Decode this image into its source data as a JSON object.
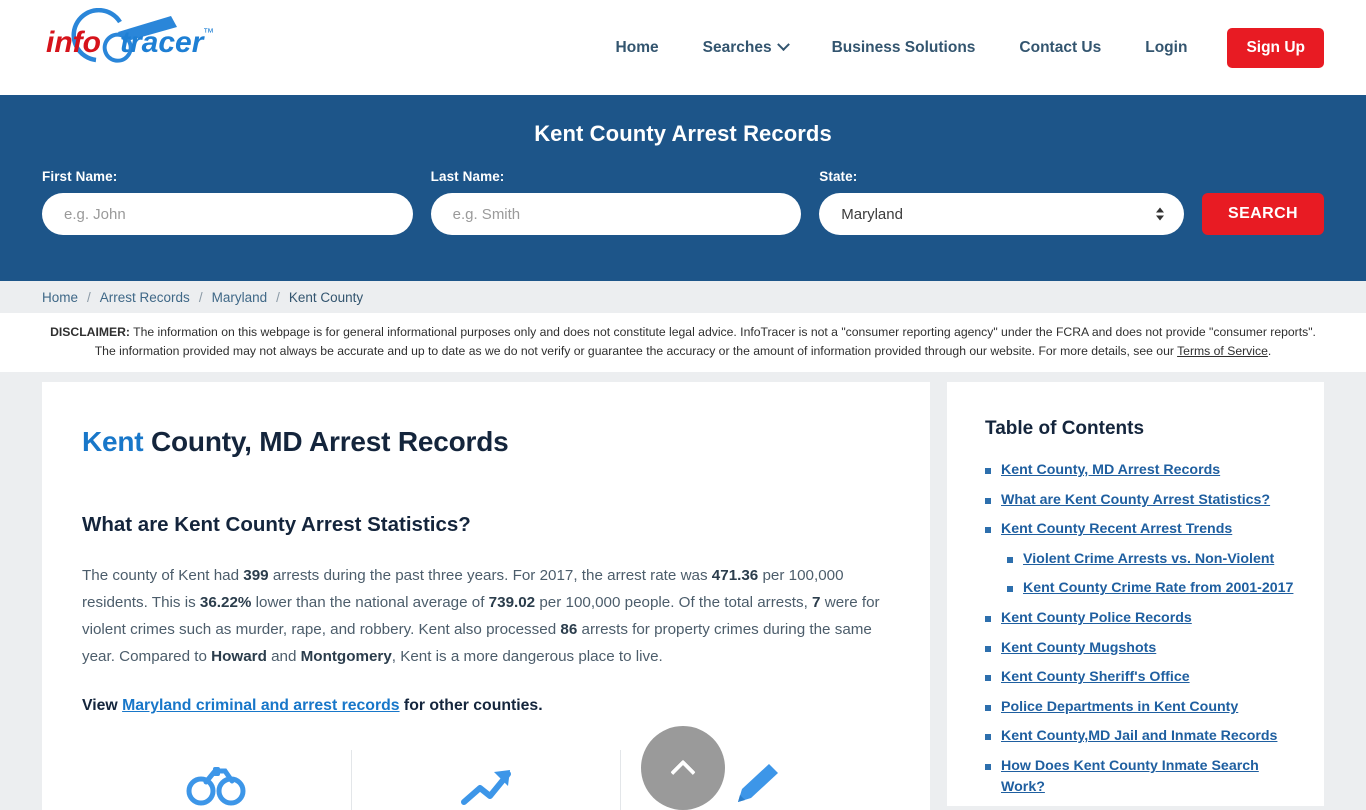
{
  "brand": {
    "logo_text_primary": "info",
    "logo_text_secondary": "tracer",
    "logo_trademark": "™"
  },
  "nav": {
    "items": [
      {
        "label": "Home",
        "has_caret": false
      },
      {
        "label": "Searches",
        "has_caret": true
      },
      {
        "label": "Business Solutions",
        "has_caret": false
      },
      {
        "label": "Contact Us",
        "has_caret": false
      },
      {
        "label": "Login",
        "has_caret": false
      }
    ],
    "signup_label": "Sign Up",
    "signup_color": "#e81b23"
  },
  "search_band": {
    "title": "Kent County Arrest Records",
    "background_color": "#1d5589",
    "first_name_label": "First Name:",
    "first_name_placeholder": "e.g. John",
    "first_name_value": "",
    "last_name_label": "Last Name:",
    "last_name_placeholder": "e.g. Smith",
    "last_name_value": "",
    "state_label": "State:",
    "state_selected": "Maryland",
    "state_options": [
      "Maryland"
    ],
    "search_button": "SEARCH"
  },
  "breadcrumb": {
    "separator": "/",
    "items": [
      {
        "label": "Home",
        "current": false
      },
      {
        "label": "Arrest Records",
        "current": false
      },
      {
        "label": "Maryland",
        "current": false
      },
      {
        "label": "Kent County",
        "current": true
      }
    ]
  },
  "disclaimer": {
    "label": "DISCLAIMER:",
    "text": " The information on this webpage is for general informational purposes only and does not constitute legal advice. InfoTracer is not a \"consumer reporting agency\" under the FCRA and does not provide \"consumer reports\". The information provided may not always be accurate and up to date as we do not verify or guarantee the accuracy or the amount of information provided through our website. For more details, see our ",
    "link_label": "Terms of Service",
    "tail": "."
  },
  "main": {
    "title_highlight": "Kent",
    "title_rest": " County, MD Arrest Records",
    "section_title": "What are Kent County Arrest Statistics?",
    "stats_paragraph": {
      "p1": "The county of Kent had ",
      "arrests_total": "399",
      "p2": " arrests during the past three years. For 2017, the arrest rate was ",
      "arrest_rate": "471.36",
      "p3": " per 100,000 residents. This is ",
      "percent_lower": "36.22%",
      "p4": " lower than the national average of ",
      "national_average": "739.02",
      "p5": " per 100,000 people. Of the total arrests, ",
      "violent_arrests": "7",
      "p6": " were for violent crimes such as murder, rape, and robbery. Kent also processed ",
      "property_arrests": "86",
      "p7": " arrests for property crimes during the same year. Compared to ",
      "compare_county_1": "Howard",
      "p8": " and ",
      "compare_county_2": "Montgomery",
      "p9": ", Kent is a more dangerous place to live."
    },
    "view_line": {
      "prefix": "View ",
      "link_label": "Maryland criminal and arrest records",
      "suffix": " for other counties."
    },
    "icons": [
      {
        "name": "handcuffs-icon"
      },
      {
        "name": "trend-arrow-icon"
      },
      {
        "name": "pen-icon"
      }
    ]
  },
  "sidebar": {
    "title": "Table of Contents",
    "items": [
      {
        "label": "Kent County, MD Arrest Records",
        "children": []
      },
      {
        "label": "What are Kent County Arrest Statistics?",
        "children": []
      },
      {
        "label": "Kent County Recent Arrest Trends",
        "children": [
          {
            "label": "Violent Crime Arrests vs. Non-Violent"
          },
          {
            "label": "Kent County Crime Rate from 2001-2017"
          }
        ]
      },
      {
        "label": "Kent County Police Records",
        "children": []
      },
      {
        "label": "Kent County Mugshots",
        "children": []
      },
      {
        "label": "Kent County Sheriff's Office",
        "children": []
      },
      {
        "label": "Police Departments in Kent County",
        "children": []
      },
      {
        "label": "Kent County,MD Jail and Inmate Records",
        "children": []
      },
      {
        "label": "How Does Kent County Inmate Search Work?",
        "children": []
      }
    ]
  },
  "scroll_top": {
    "name": "scroll-to-top-button"
  }
}
